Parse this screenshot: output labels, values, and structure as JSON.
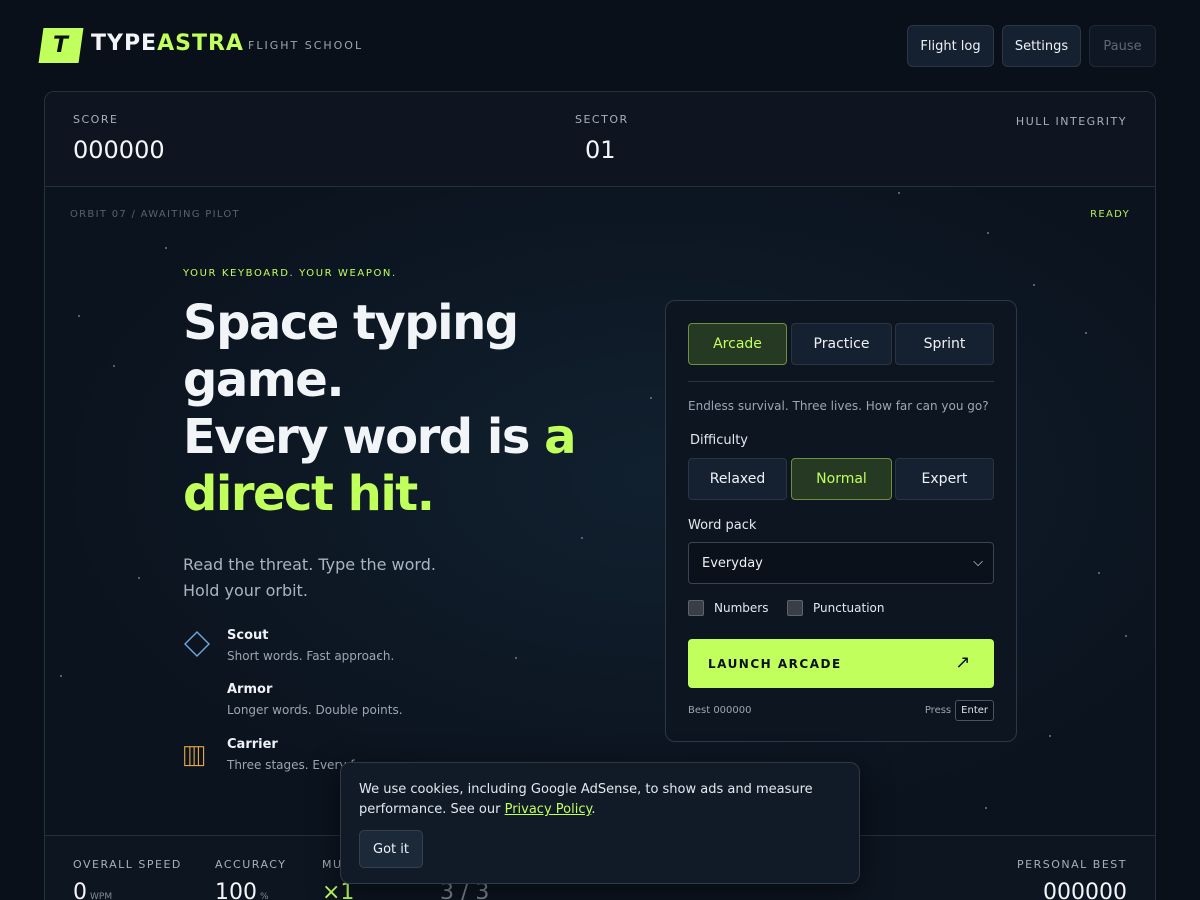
{
  "header": {
    "logo_letter": "T",
    "brand_part1": "TYPE",
    "brand_part2": "ASTRA",
    "tagline": "FLIGHT SCHOOL",
    "buttons": {
      "flight_log": "Flight log",
      "settings": "Settings",
      "pause": "Pause"
    }
  },
  "stats": {
    "score_label": "SCORE",
    "score": "000000",
    "sector_label": "SECTOR",
    "sector": "01",
    "hull_label": "HULL INTEGRITY"
  },
  "arena": {
    "orbit_status": "ORBIT 07 / AWAITING PILOT",
    "ready": "READY",
    "kicker": "YOUR KEYBOARD. YOUR WEAPON.",
    "headline_line1": "Space typing",
    "headline_line2": "game.",
    "headline_line3a": "Every word is ",
    "headline_line3b": "a",
    "headline_line4": "direct hit.",
    "lede_line1": "Read the threat. Type the word.",
    "lede_line2": "Hold your orbit.",
    "enemies": [
      {
        "name": "Scout",
        "desc": "Short words. Fast approach.",
        "icon": "diamond-icon",
        "color": "#6fa8dc"
      },
      {
        "name": "Armor",
        "desc": "Longer words. Double points.",
        "icon": "none"
      },
      {
        "name": "Carrier",
        "desc": "Three stages. Every f...",
        "icon": "bars-icon",
        "color": "#e9a94a"
      }
    ]
  },
  "config": {
    "modes": [
      "Arcade",
      "Practice",
      "Sprint"
    ],
    "active_mode": "Arcade",
    "mode_desc": "Endless survival. Three lives. How far can you go?",
    "difficulty_label": "Difficulty",
    "difficulties": [
      "Relaxed",
      "Normal",
      "Expert"
    ],
    "active_difficulty": "Normal",
    "word_pack_label": "Word pack",
    "word_pack": "Everyday",
    "options": [
      "Numbers",
      "Punctuation"
    ],
    "launch": "LAUNCH ARCADE",
    "best": "Best 000000",
    "press": "Press",
    "key": "Enter"
  },
  "bottom": {
    "speed_label": "OVERALL SPEED",
    "speed": "0",
    "speed_unit": "WPM",
    "accuracy_label": "ACCURACY",
    "accuracy": "100",
    "accuracy_unit": "%",
    "multiplier_label": "MU",
    "multiplier": "×1",
    "lives": "3 / 3",
    "best_label": "PERSONAL BEST",
    "best": "000000"
  },
  "cookie": {
    "text": "We use cookies, including Google AdSense, to show ads and measure performance. See our ",
    "link": "Privacy Policy",
    "tail": ".",
    "button": "Got it"
  },
  "colors": {
    "accent": "#c0ff5c",
    "background": "#0a1019"
  }
}
